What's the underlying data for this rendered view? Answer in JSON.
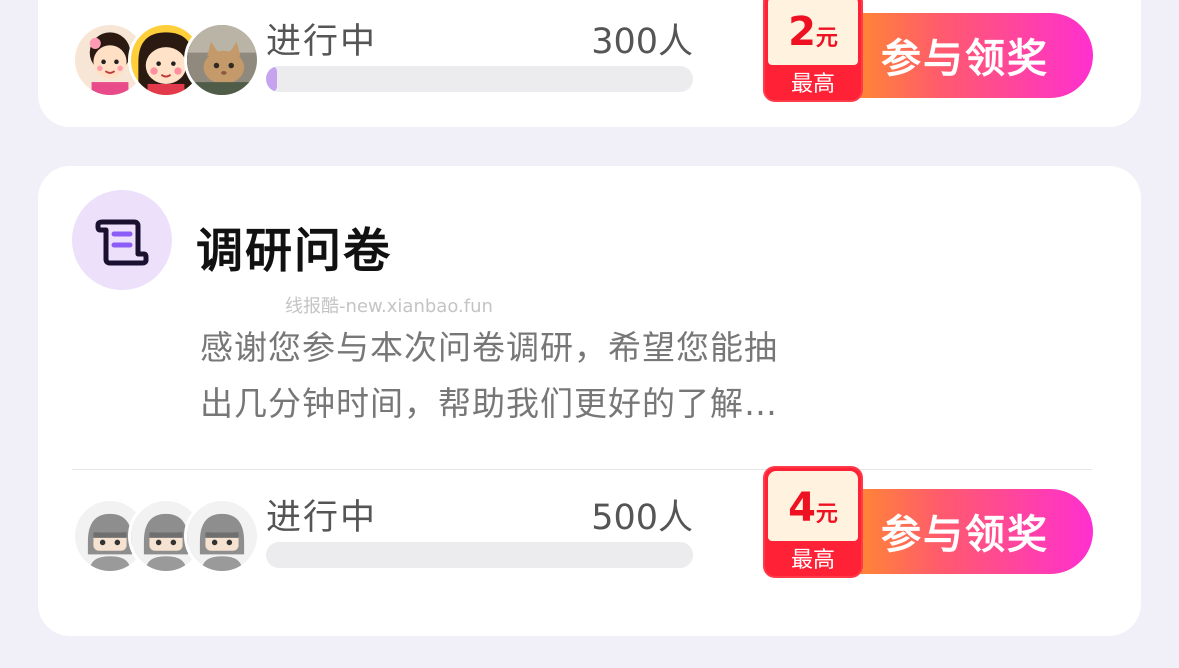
{
  "tasks": [
    {
      "status": "进行中",
      "count": "300人",
      "progress": 0.025,
      "reward_amount": "2",
      "reward_unit": "元",
      "reward_label": "最高",
      "cta_label": "参与领奖"
    },
    {
      "title": "调研问卷",
      "watermark": "线报酷-new.xianbao.fun",
      "description_line1": "感谢您参与本次问卷调研，希望您能抽",
      "description_line2": "出几分钟时间，帮助我们更好的了解…",
      "status": "进行中",
      "count": "500人",
      "progress": 0,
      "reward_amount": "4",
      "reward_unit": "元",
      "reward_label": "最高",
      "cta_label": "参与领奖"
    }
  ],
  "colors": {
    "background": "#f1eff8",
    "progress_fill": "#c6a3ef",
    "reward_red": "#ee1122",
    "cta_gradient_start": "#ff9a1a",
    "cta_gradient_end": "#ff2fd0"
  },
  "icons": {
    "title_icon": "scroll-icon",
    "avatars_task1": [
      "cartoon-girl-avatar",
      "cartoon-girl-avatar",
      "cat-avatar"
    ],
    "avatars_task2": [
      "default-user-avatar",
      "default-user-avatar",
      "default-user-avatar"
    ]
  }
}
